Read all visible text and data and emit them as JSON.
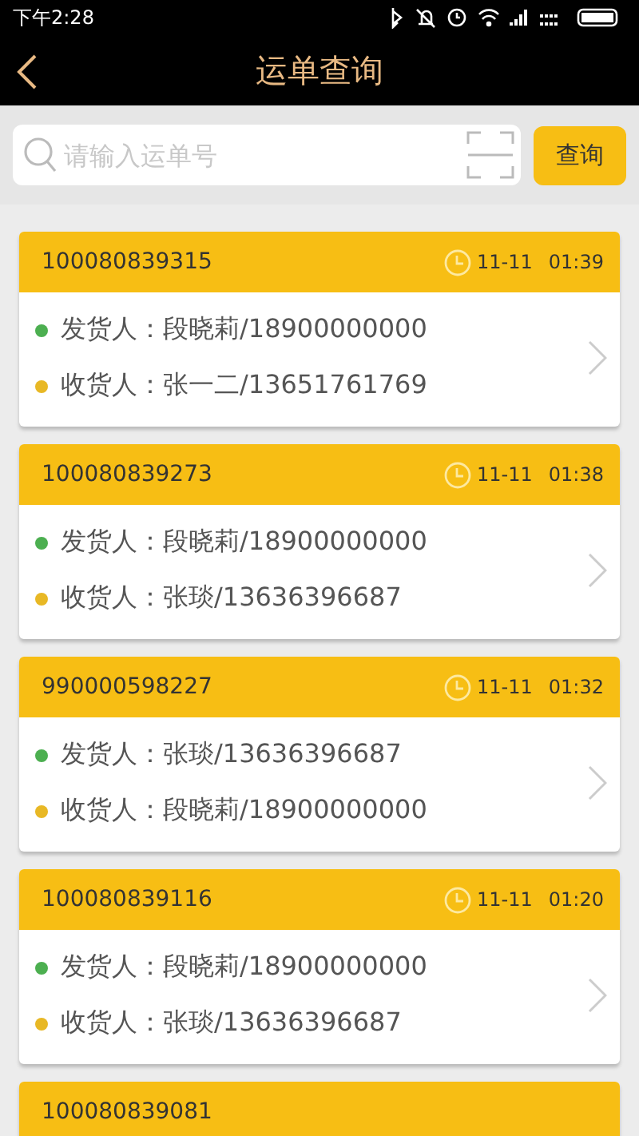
{
  "status_bar": {
    "time": "下午2:28"
  },
  "nav": {
    "title": "运单查询"
  },
  "search": {
    "placeholder": "请输入运单号",
    "button": "查询"
  },
  "waybills": [
    {
      "number": "100080839315",
      "date": "11-11",
      "time": "01:39",
      "parties": [
        {
          "label": "发货人：段晓莉/18900000000",
          "color": "#4caf50"
        },
        {
          "label": "收货人：张一二/13651761769",
          "color": "#e8b825"
        }
      ]
    },
    {
      "number": "100080839273",
      "date": "11-11",
      "time": "01:38",
      "parties": [
        {
          "label": "发货人：段晓莉/18900000000",
          "color": "#4caf50"
        },
        {
          "label": "收货人：张琰/13636396687",
          "color": "#e8b825"
        }
      ]
    },
    {
      "number": "990000598227",
      "date": "11-11",
      "time": "01:32",
      "parties": [
        {
          "label": "发货人：张琰/13636396687",
          "color": "#4caf50"
        },
        {
          "label": "收货人：段晓莉/18900000000",
          "color": "#e8b825"
        }
      ]
    },
    {
      "number": "100080839116",
      "date": "11-11",
      "time": "01:20",
      "parties": [
        {
          "label": "发货人：段晓莉/18900000000",
          "color": "#4caf50"
        },
        {
          "label": "收货人：张琰/13636396687",
          "color": "#e8b825"
        }
      ]
    },
    {
      "number": "100080839081"
    }
  ]
}
